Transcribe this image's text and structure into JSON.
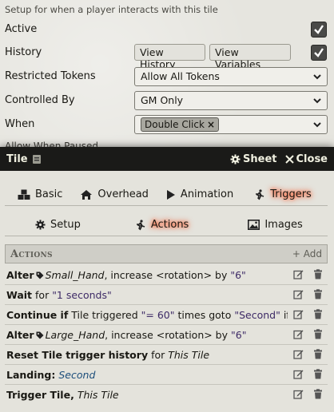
{
  "background_window": {
    "hint": "Setup for when a player interacts with this tile",
    "rows": {
      "active": {
        "label": "Active"
      },
      "history": {
        "label": "History",
        "btn_view_history": "View History",
        "btn_view_variables": "View Variables"
      },
      "restricted": {
        "label": "Restricted Tokens",
        "value": "Allow All Tokens"
      },
      "controlled": {
        "label": "Controlled By",
        "value": "GM Only"
      },
      "when": {
        "label": "When",
        "chip": "Double Click"
      },
      "paused": {
        "label": "Allow When Paused"
      }
    }
  },
  "window": {
    "title": "Tile",
    "sheet_label": "Sheet",
    "close_label": "Close",
    "tabs": [
      "Basic",
      "Overhead",
      "Animation",
      "Triggers"
    ],
    "subtabs": [
      "Setup",
      "Actions",
      "Images"
    ],
    "actions_header": "Actions",
    "add_label": "+ Add",
    "actions": [
      {
        "b": "Alter",
        "tag": "Small_Hand",
        "rest": ", increase <rotation> by ",
        "val": "\"6\""
      },
      {
        "b": "Wait",
        "rest": " for ",
        "val": "\"1 seconds\""
      },
      {
        "b": "Continue if",
        "rest": " Tile triggered ",
        "val": "\"= 60\"",
        "rest2": " times goto ",
        "val2": "\"Second\"",
        "rest3": " if it hasn't"
      },
      {
        "b": "Alter",
        "tag": "Large_Hand",
        "rest": ", increase <rotation> by ",
        "val": "\"6\""
      },
      {
        "b": "Reset Tile trigger history",
        "rest": " for ",
        "it": "This Tile"
      },
      {
        "b": "Landing:",
        "blue": "Second"
      },
      {
        "b": "Trigger Tile,",
        "it": "This Tile"
      }
    ]
  }
}
